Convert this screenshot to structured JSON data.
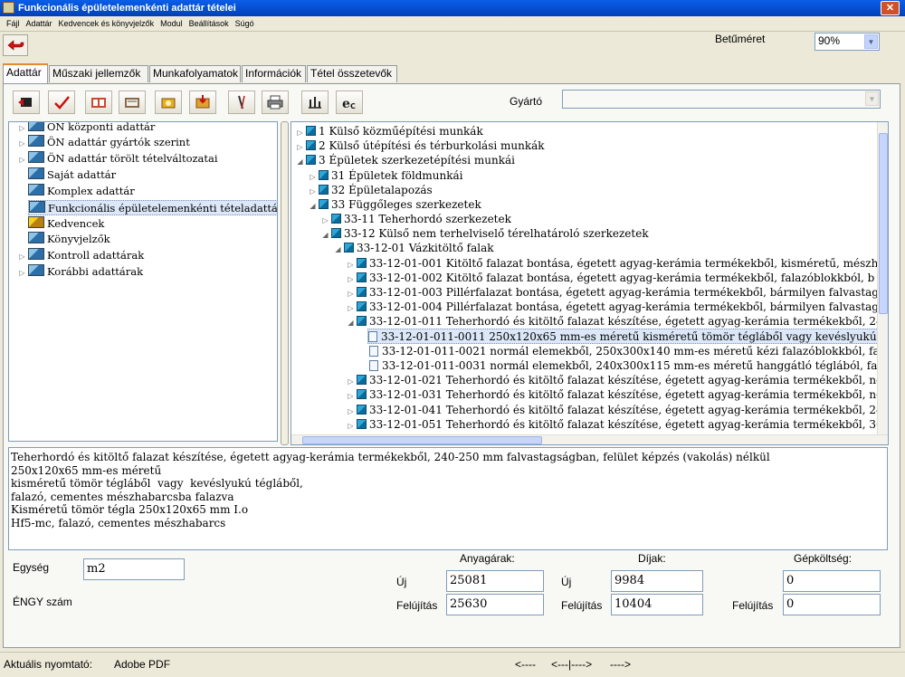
{
  "window": {
    "title": "Funkcionális épületelemenkénti adattár tételei"
  },
  "menu": [
    "Fájl",
    "Adattár",
    "Kedvencek és könyvjelzők",
    "Modul",
    "Beállítások",
    "Súgó"
  ],
  "font_size": {
    "label": "Betűméret",
    "value": "90%"
  },
  "tabs": [
    "Adattár",
    "Műszaki jellemzők",
    "Munkafolyamatok",
    "Információk",
    "Tétel összetevők"
  ],
  "toolbar": {
    "buttons": [
      "exit-icon",
      "check-icon",
      "open-book-icon",
      "edit-book-icon",
      "box-icon",
      "import-icon",
      "pen-icon",
      "print-icon",
      "chart-icon",
      "ie-icon"
    ],
    "manufacturer_label": "Gyártó",
    "manufacturer_value": ""
  },
  "left_tree": [
    "ÖN központi adattár",
    "ÖN adattár gyártók szerint",
    "ÖN adattár törölt tételváltozatai",
    "Saját adattár",
    "Komplex adattár",
    "Funkcionális épületelemenkénti tételadattár",
    "Kedvencek",
    "Könyvjelzők",
    "Kontroll adattárak",
    "Korábbi adattárak"
  ],
  "right_tree": [
    "1 Külső közműépítési munkák",
    "2 Külső útépítési és térburkolási munkák",
    "3 Épületek szerkezetépítési munkái",
    "31 Épületek földmunkái",
    "32 Épületalapozás",
    "33 Függőleges szerkezetek",
    "33-11 Teherhordó szerkezetek",
    "33-12 Külső nem terhelviselő térelhatároló szerkezetek",
    "33-12-01 Vázkitöltő falak",
    "33-12-01-001 Kitöltő falazat bontása, égetett agyag-kerámia termékekből,  kisméretű, mészh",
    "33-12-01-002 Kitöltő falazat bontása, égetett agyag-kerámia termékekből, falazóblokkból, b",
    "33-12-01-003 Pillérfalazat bontása, égetett agyag-kerámia termékekből, bármilyen falvastag",
    "33-12-01-004 Pillérfalazat bontása, égetett agyag-kerámia termékekből, bármilyen falvastag",
    "33-12-01-011 Teherhordó és kitöltő falazat készítése, égetett agyag-kerámia termékekből, 24",
    "33-12-01-011-0011 250x120x65 mm-es méretű kisméretű tömör tégláből  vagy  kevéslyukú tég",
    "33-12-01-011-0021 normál elemekből, 250x300x140 mm-es méretű kézi falazóblokkból, fala",
    "33-12-01-011-0031 normál elemekből, 240x300x115 mm-es méretű hanggátló téglából, falaz",
    "33-12-01-021 Teherhordó és kitöltő falazat készítése, égetett agyag-kerámia termékekből, ne",
    "33-12-01-031 Teherhordó és kitöltő falazat készítése, égetett agyag-kerámia termékekből, ne",
    "33-12-01-041 Teherhordó és kitöltő falazat készítése, égetett agyag-kerámia termékekből, 24",
    "33-12-01-051 Teherhordó és kitöltő falazat készítése, égetett agyag-kerámia termékekből, 30"
  ],
  "description": "Teherhordó és kitöltő falazat készítése, égetett agyag-kerámia termékekből, 240-250 mm falvastagságban, felület képzés (vakolás) nélkül\n250x120x65 mm-es méretű\nkisméretű tömör tégláből  vagy  kevéslyukú tégláből,\nfalazó, cementes mészhabarcsba falazva\nKisméretű tömör tégla 250x120x65 mm I.o\nHf5-mc, falazó, cementes mészhabarcs",
  "fields": {
    "unit_label": "Egység",
    "unit_value": "m2",
    "engy_label": "ÉNGY szám",
    "material_header": "Anyagárak:",
    "fee_header": "Díjak:",
    "machine_header": "Gépköltség:",
    "new_label": "Új",
    "renew_label": "Felújítás",
    "material_new": "25081",
    "material_renew": "25630",
    "fee_new": "9984",
    "fee_renew": "10404",
    "machine_new": "0",
    "machine_renew": "0"
  },
  "status": {
    "printer_label": "Aktuális nyomtató:",
    "printer_value": "Adobe PDF",
    "nav_prev": "<----",
    "nav_mid": "<---|---->",
    "nav_next": "---->"
  }
}
